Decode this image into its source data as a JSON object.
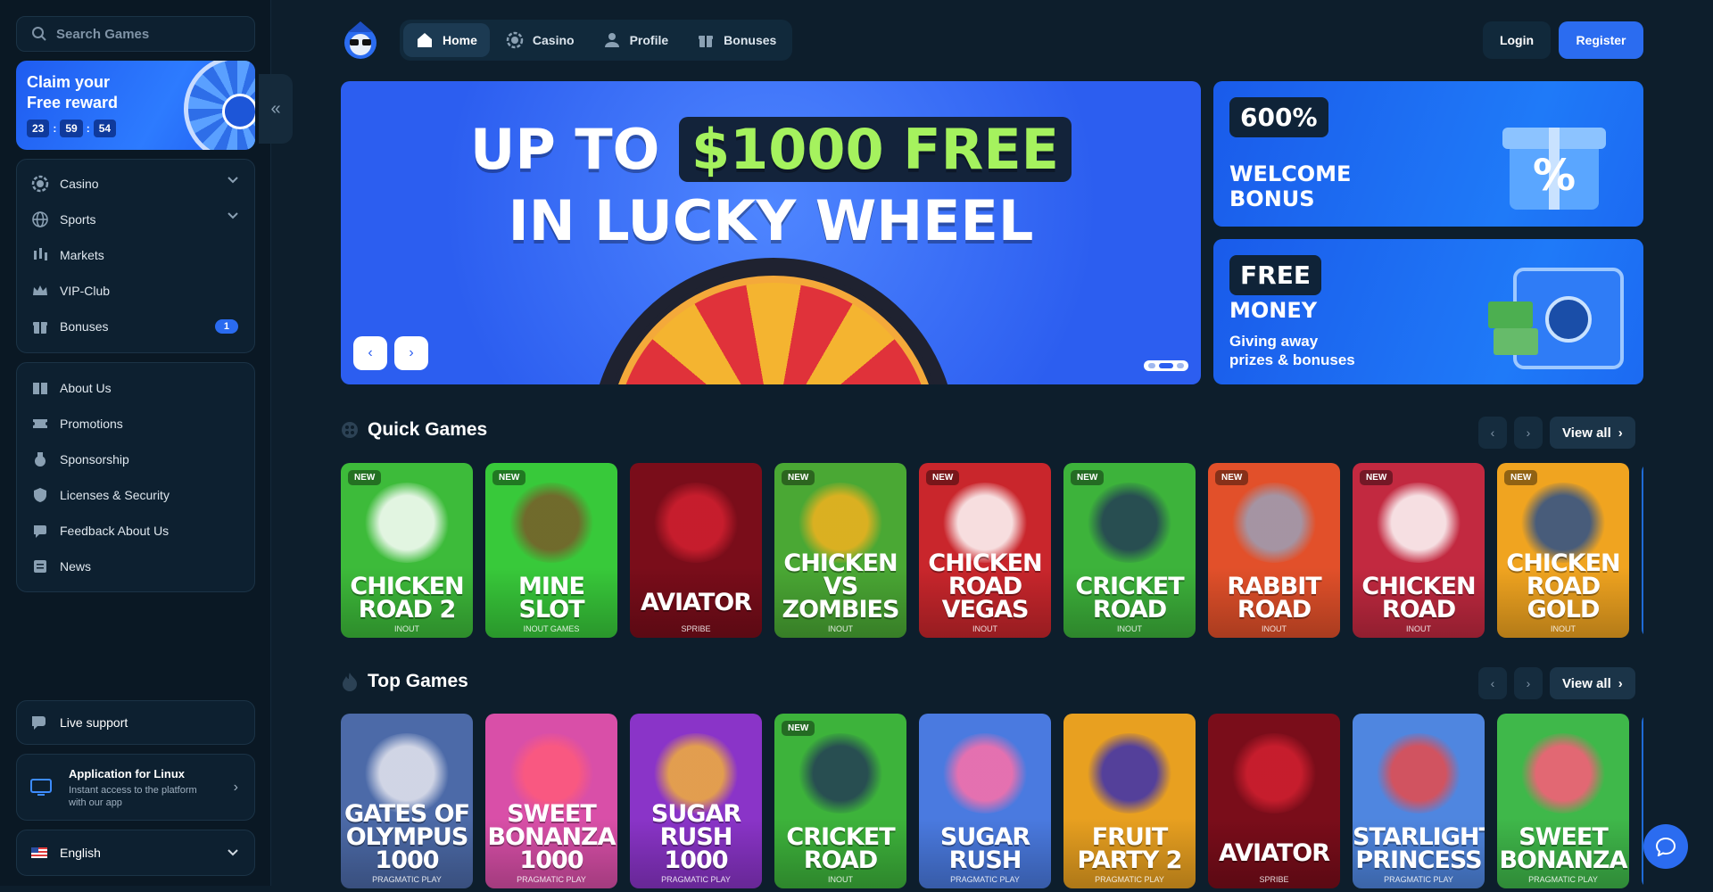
{
  "sidebar": {
    "search_placeholder": "Search Games",
    "promo": {
      "title_line1": "Claim your",
      "title_line2": "Free reward",
      "timer": {
        "h": "23",
        "m": "59",
        "s": "54",
        "sep": ":"
      }
    },
    "menu1": [
      {
        "label": "Casino",
        "icon": "casino-chip-icon",
        "has_chevron": true
      },
      {
        "label": "Sports",
        "icon": "globe-icon",
        "has_chevron": true
      },
      {
        "label": "Markets",
        "icon": "candlestick-icon"
      },
      {
        "label": "VIP-Club",
        "icon": "crown-icon"
      },
      {
        "label": "Bonuses",
        "icon": "gift-icon",
        "badge": "1"
      }
    ],
    "menu2": [
      {
        "label": "About Us",
        "icon": "book-icon"
      },
      {
        "label": "Promotions",
        "icon": "ticket-icon"
      },
      {
        "label": "Sponsorship",
        "icon": "medal-icon"
      },
      {
        "label": "Licenses & Security",
        "icon": "shield-icon"
      },
      {
        "label": "Feedback About Us",
        "icon": "chat-bubble-icon"
      },
      {
        "label": "News",
        "icon": "newspaper-icon"
      }
    ],
    "support": "Live support",
    "app": {
      "title": "Application for Linux",
      "desc_line1": "Instant access to the platform",
      "desc_line2": "with our app"
    },
    "language": "English"
  },
  "header": {
    "tabs": [
      {
        "label": "Home",
        "icon": "home-icon",
        "active": true
      },
      {
        "label": "Casino",
        "icon": "casino-chip-icon"
      },
      {
        "label": "Profile",
        "icon": "user-icon"
      },
      {
        "label": "Bonuses",
        "icon": "gift-icon"
      }
    ],
    "login": "Login",
    "register": "Register"
  },
  "hero": {
    "line1_pre": "UP TO",
    "line1_highlight": "$1000 FREE",
    "line2": "IN LUCKY WHEEL"
  },
  "side_banners": [
    {
      "tag": "600%",
      "line1": "WELCOME",
      "line2": "BONUS"
    },
    {
      "tag": "FREE",
      "line1": "MONEY",
      "sub1": "Giving away",
      "sub2": "prizes & bonuses"
    }
  ],
  "quick_games": {
    "title": "Quick Games",
    "view_all": "View all",
    "items": [
      {
        "l1": "CHICKEN",
        "l2": "ROAD 2",
        "provider": "INOUT",
        "new": true,
        "bg": "#3dbb3a",
        "art": "#ffffff"
      },
      {
        "l1": "MINE",
        "l2": "SLOT",
        "provider": "INOUT GAMES",
        "new": true,
        "bg": "#38c93a",
        "art": "#7a5a2a"
      },
      {
        "l1": "AVIATOR",
        "l2": "",
        "provider": "SPRIBE",
        "new": false,
        "bg": "#7a0d1a",
        "art": "#d32030"
      },
      {
        "l1": "CHICKEN",
        "l2": "VS ZOMBIES",
        "provider": "INOUT",
        "new": true,
        "bg": "#4aa834",
        "art": "#f3b21e"
      },
      {
        "l1": "CHICKEN",
        "l2": "ROAD VEGAS",
        "provider": "INOUT",
        "new": true,
        "bg": "#c9262c",
        "art": "#ffffff"
      },
      {
        "l1": "CRICKET",
        "l2": "ROAD",
        "provider": "INOUT",
        "new": true,
        "bg": "#3db33b",
        "art": "#243c55"
      },
      {
        "l1": "RABBIT",
        "l2": "ROAD",
        "provider": "INOUT",
        "new": true,
        "bg": "#e2502a",
        "art": "#9aa0b8"
      },
      {
        "l1": "CHICKEN",
        "l2": "ROAD",
        "provider": "INOUT",
        "new": true,
        "bg": "#c22940",
        "art": "#ffffff"
      },
      {
        "l1": "CHICKEN",
        "l2": "ROAD GOLD",
        "provider": "INOUT",
        "new": true,
        "bg": "#f0a420",
        "art": "#2a4f8a"
      }
    ]
  },
  "top_games": {
    "title": "Top Games",
    "view_all": "View all",
    "items": [
      {
        "l1": "GATES OF",
        "l2": "OLYMPUS",
        "l3": "1000",
        "provider": "PRAGMATIC PLAY",
        "new": false,
        "bg": "#4c6aa8",
        "art": "#e8e8f0"
      },
      {
        "l1": "SWEET",
        "l2": "BONANZA",
        "l3": "1000",
        "provider": "PRAGMATIC PLAY",
        "new": false,
        "bg": "#d94fa8",
        "art": "#ff5a7a"
      },
      {
        "l1": "SUGAR",
        "l2": "RUSH",
        "l3": "1000",
        "provider": "PRAGMATIC PLAY",
        "new": false,
        "bg": "#8a34c8",
        "art": "#f2b03a"
      },
      {
        "l1": "CRICKET",
        "l2": "ROAD",
        "l3": "",
        "provider": "INOUT",
        "new": true,
        "bg": "#3db33b",
        "art": "#243c55"
      },
      {
        "l1": "SUGAR",
        "l2": "RUSH",
        "l3": "",
        "provider": "PRAGMATIC PLAY",
        "new": false,
        "bg": "#4a7ae0",
        "art": "#ff6fa8"
      },
      {
        "l1": "FRUIT",
        "l2": "PARTY 2",
        "l3": "",
        "provider": "PRAGMATIC PLAY",
        "new": false,
        "bg": "#e8a020",
        "art": "#3a2fb0"
      },
      {
        "l1": "AVIATOR",
        "l2": "",
        "l3": "",
        "provider": "SPRIBE",
        "new": false,
        "bg": "#7a0d1a",
        "art": "#d32030"
      },
      {
        "l1": "STARLIGHT",
        "l2": "PRINCESS",
        "l3": "",
        "provider": "PRAGMATIC PLAY",
        "new": false,
        "bg": "#4f86e0",
        "art": "#e84a4a"
      },
      {
        "l1": "SWEET",
        "l2": "BONANZA",
        "l3": "",
        "provider": "PRAGMATIC PLAY",
        "new": false,
        "bg": "#3fb84a",
        "art": "#ff5a7a"
      }
    ]
  }
}
